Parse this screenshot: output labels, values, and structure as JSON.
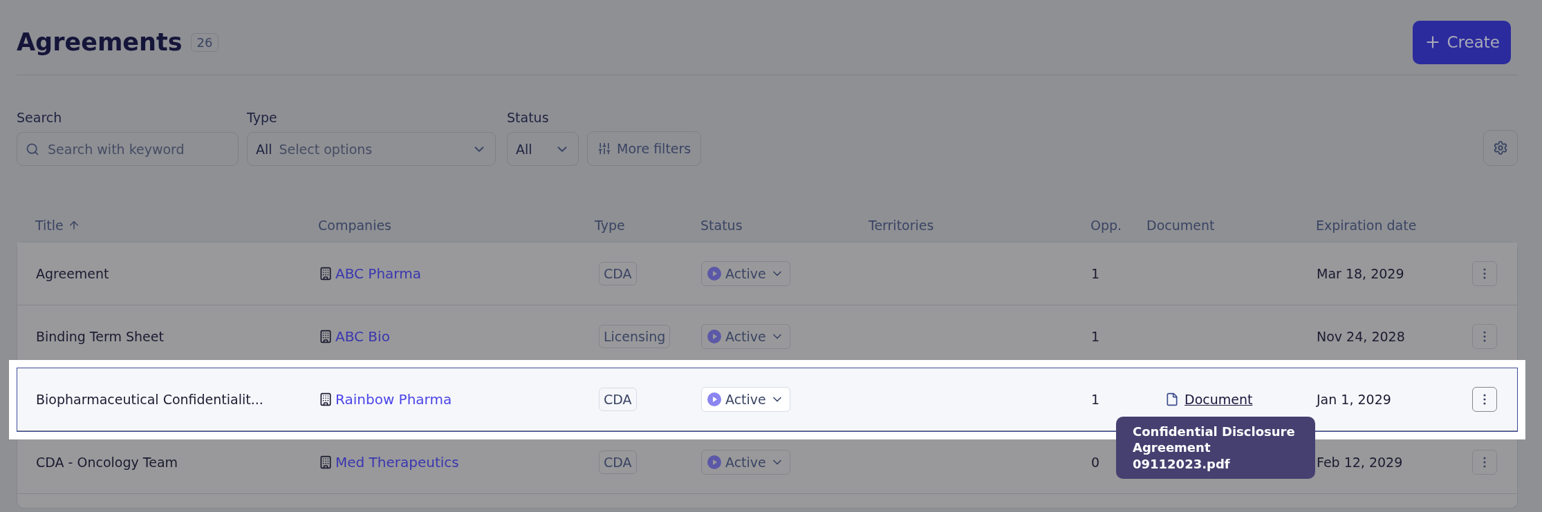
{
  "header": {
    "title": "Agreements",
    "count": "26",
    "create_button": "Create"
  },
  "filters": {
    "search": {
      "label": "Search",
      "placeholder": "Search with keyword"
    },
    "type": {
      "label": "Type",
      "value": "All",
      "placeholder": "Select options"
    },
    "status": {
      "label": "Status",
      "value": "All"
    },
    "more_filters": "More filters"
  },
  "table": {
    "columns": [
      {
        "label": "Title",
        "sorted": true
      },
      {
        "label": "Companies",
        "sorted": false
      },
      {
        "label": "Type",
        "sorted": false
      },
      {
        "label": "Status",
        "sorted": false
      },
      {
        "label": "Territories",
        "sorted": false
      },
      {
        "label": "Opp.",
        "sorted": false
      },
      {
        "label": "Document",
        "sorted": false
      },
      {
        "label": "Expiration date",
        "sorted": false
      }
    ],
    "rows": [
      {
        "title": "Agreement",
        "company": "ABC Pharma",
        "type": "CDA",
        "status": "Active",
        "opp": "1",
        "document": null,
        "expiration": "Mar 18, 2029",
        "highlighted": false
      },
      {
        "title": "Binding Term Sheet",
        "company": "ABC Bio",
        "type": "Licensing",
        "status": "Active",
        "opp": "1",
        "document": null,
        "expiration": "Nov 24, 2028",
        "highlighted": false
      },
      {
        "title": "Biopharmaceutical Confidentialit...",
        "company": "Rainbow Pharma",
        "type": "CDA",
        "status": "Active",
        "opp": "1",
        "document": {
          "label": "Document",
          "tooltip": "Confidential Disclosure Agreement 09112023.pdf"
        },
        "expiration": "Jan 1, 2029",
        "highlighted": true
      },
      {
        "title": "CDA - Oncology Team",
        "company": "Med Therapeutics",
        "type": "CDA",
        "status": "Active",
        "opp": "0",
        "document": null,
        "expiration": "Feb 12, 2029",
        "highlighted": false
      }
    ]
  }
}
